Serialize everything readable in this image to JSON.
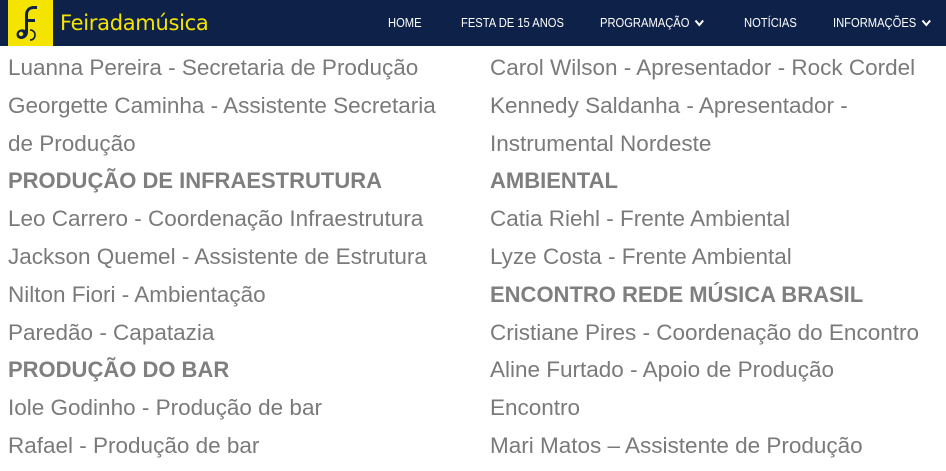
{
  "nav": {
    "logo_text": "Feiradamúsica",
    "items": [
      {
        "label": "HOME"
      },
      {
        "label": "FESTA DE 15 ANOS"
      },
      {
        "label": "PROGRAMAÇÃO"
      },
      {
        "label": "NOTÍCIAS"
      },
      {
        "label": "INFORMAÇÕES"
      }
    ]
  },
  "colors": {
    "navbar_bg": "#0d2149",
    "logo_yellow": "#f5e400",
    "text_gray": "#7a7a7a"
  },
  "content": {
    "left_column": [
      {
        "text": "Luanna Pereira - Secretaria de Produção",
        "kind": "entry"
      },
      {
        "text": "Georgette Caminha - Assistente Secretaria",
        "kind": "entry"
      },
      {
        "text": "de Produção",
        "kind": "entry"
      },
      {
        "text": "PRODUÇÃO DE INFRAESTRUTURA",
        "kind": "heading"
      },
      {
        "text": "Leo Carrero - Coordenação Infraestrutura",
        "kind": "entry"
      },
      {
        "text": "Jackson Quemel - Assistente de Estrutura",
        "kind": "entry"
      },
      {
        "text": "Nilton Fiori - Ambientação",
        "kind": "entry"
      },
      {
        "text": "Paredão - Capatazia",
        "kind": "entry"
      },
      {
        "text": "PRODUÇÃO DO BAR",
        "kind": "heading"
      },
      {
        "text": "Iole Godinho - Produção de bar",
        "kind": "entry"
      },
      {
        "text": "Rafael - Produção de bar",
        "kind": "entry"
      }
    ],
    "right_column": [
      {
        "text": "Carol Wilson - Apresentador - Rock Cordel",
        "kind": "entry"
      },
      {
        "text": "Kennedy Saldanha - Apresentador -",
        "kind": "entry"
      },
      {
        "text": "Instrumental Nordeste",
        "kind": "entry"
      },
      {
        "text": "AMBIENTAL",
        "kind": "heading"
      },
      {
        "text": "Catia Riehl - Frente Ambiental",
        "kind": "entry"
      },
      {
        "text": "Lyze Costa - Frente Ambiental",
        "kind": "entry"
      },
      {
        "text": "ENCONTRO REDE MÚSICA BRASIL",
        "kind": "heading"
      },
      {
        "text": "Cristiane Pires - Coordenação do Encontro",
        "kind": "entry"
      },
      {
        "text": "Aline Furtado - Apoio de Produção",
        "kind": "entry"
      },
      {
        "text": "Encontro",
        "kind": "entry"
      },
      {
        "text": "Mari Matos – Assistente de Produção",
        "kind": "entry"
      }
    ]
  }
}
